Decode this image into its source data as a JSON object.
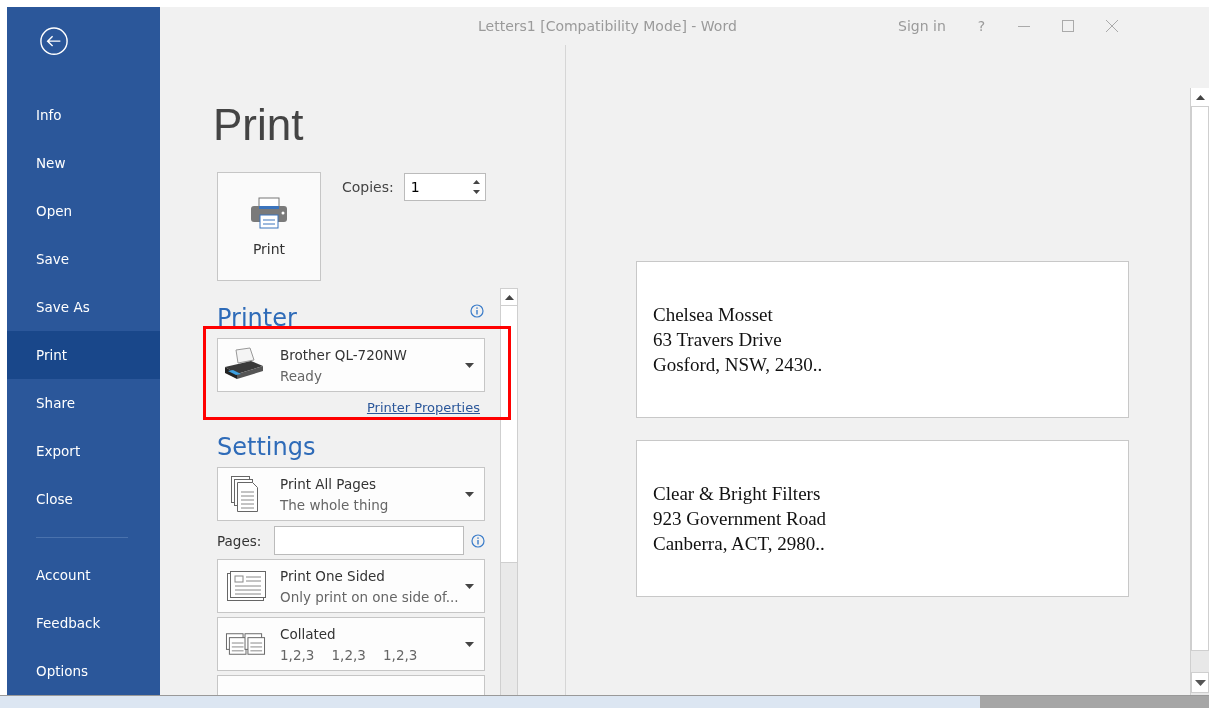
{
  "window": {
    "title": "Letters1 [Compatibility Mode]  -  Word",
    "sign_in": "Sign in",
    "help": "?"
  },
  "sidebar": {
    "groups": [
      [
        {
          "label": "Info",
          "selected": false
        },
        {
          "label": "New",
          "selected": false
        },
        {
          "label": "Open",
          "selected": false
        },
        {
          "label": "Save",
          "selected": false
        },
        {
          "label": "Save As",
          "selected": false
        },
        {
          "label": "Print",
          "selected": true
        },
        {
          "label": "Share",
          "selected": false
        },
        {
          "label": "Export",
          "selected": false
        },
        {
          "label": "Close",
          "selected": false
        }
      ],
      [
        {
          "label": "Account",
          "selected": false
        },
        {
          "label": "Feedback",
          "selected": false
        },
        {
          "label": "Options",
          "selected": false
        }
      ]
    ]
  },
  "page_title": "Print",
  "print_button": {
    "label": "Print"
  },
  "copies": {
    "label": "Copies:",
    "value": "1"
  },
  "printer": {
    "heading": "Printer",
    "name": "Brother QL-720NW",
    "status": "Ready",
    "properties_link": "Printer Properties",
    "highlighted": true
  },
  "settings": {
    "heading": "Settings",
    "items": [
      {
        "kind": "dropdown",
        "title": "Print All Pages",
        "subtitle": "The whole thing"
      },
      {
        "kind": "pages_field",
        "label": "Pages:"
      },
      {
        "kind": "dropdown",
        "title": "Print One Sided",
        "subtitle": "Only print on one side of..."
      },
      {
        "kind": "dropdown",
        "title": "Collated",
        "subtitle": "1,2,3    1,2,3    1,2,3"
      },
      {
        "kind": "cut_off"
      }
    ]
  },
  "preview": {
    "labels": [
      {
        "lines": [
          "Chelsea Mosset",
          "63 Travers Drive",
          "Gosford, NSW, 2430.."
        ]
      },
      {
        "lines": [
          "Clear & Bright Filters",
          "923 Government Road",
          "Canberra, ACT, 2980.."
        ]
      }
    ]
  }
}
